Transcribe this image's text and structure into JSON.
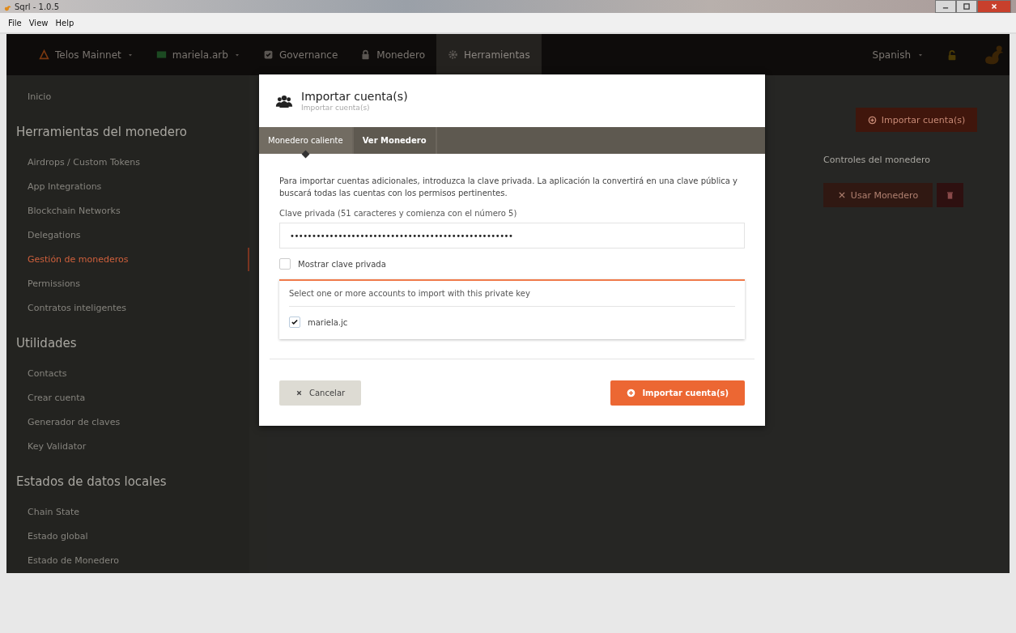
{
  "window": {
    "title": "Sqrl - 1.0.5"
  },
  "menu": [
    "File",
    "View",
    "Help"
  ],
  "nav": {
    "items": [
      {
        "label": "Telos Mainnet",
        "kind": "dropdown",
        "selected": false
      },
      {
        "label": "mariela.arb",
        "kind": "dropdown",
        "selected": false
      },
      {
        "label": "Governance",
        "kind": "link",
        "selected": false
      },
      {
        "label": "Monedero",
        "kind": "link",
        "selected": false
      },
      {
        "label": "Herramientas",
        "kind": "link",
        "selected": true
      }
    ],
    "language": "Spanish"
  },
  "sidebar": {
    "sections": [
      {
        "items": [
          {
            "label": "Inicio",
            "selected": false
          }
        ]
      },
      {
        "heading": "Herramientas del monedero",
        "items": [
          {
            "label": "Airdrops / Custom Tokens",
            "selected": false
          },
          {
            "label": "App Integrations",
            "selected": false
          },
          {
            "label": "Blockchain Networks",
            "selected": false
          },
          {
            "label": "Delegations",
            "selected": false
          },
          {
            "label": "Gestión de monederos",
            "selected": true
          },
          {
            "label": "Permissions",
            "selected": false
          },
          {
            "label": "Contratos inteligentes",
            "selected": false
          }
        ]
      },
      {
        "heading": "Utilidades",
        "items": [
          {
            "label": "Contacts",
            "selected": false
          },
          {
            "label": "Crear cuenta",
            "selected": false
          },
          {
            "label": "Generador de claves",
            "selected": false
          },
          {
            "label": "Key Validator",
            "selected": false
          }
        ]
      },
      {
        "heading": "Estados de datos locales",
        "items": [
          {
            "label": "Chain State",
            "selected": false
          },
          {
            "label": "Estado global",
            "selected": false
          },
          {
            "label": "Estado de Monedero",
            "selected": false
          }
        ]
      }
    ]
  },
  "main": {
    "import_button": "Importar cuenta(s)",
    "controls_heading": "Controles del monedero",
    "use_button": "Usar Monedero"
  },
  "modal": {
    "title": "Importar cuenta(s)",
    "subtitle": "Importar cuenta(s)",
    "tabs": [
      {
        "label": "Monedero caliente",
        "selected": true
      },
      {
        "label": "Ver Monedero",
        "selected": false
      }
    ],
    "intro": "Para importar cuentas adicionales, introduzca la clave privada. La aplicación la convertirá en una clave pública y buscará todas las cuentas con los permisos pertinentes.",
    "key_field": {
      "label": "Clave privada (51 caracteres y comienza con el número 5)",
      "value": "•••••••••••••••••••••••••••••••••••••••••••••••••••"
    },
    "show_key": {
      "label": "Mostrar clave privada",
      "checked": false
    },
    "accounts": {
      "prompt": "Select one or more accounts to import with this private key",
      "items": [
        {
          "name": "mariela.jc",
          "checked": true
        }
      ]
    },
    "buttons": [
      {
        "label": "Cancelar",
        "kind": "cancel"
      },
      {
        "label": "Importar cuenta(s)",
        "kind": "primary"
      }
    ]
  }
}
